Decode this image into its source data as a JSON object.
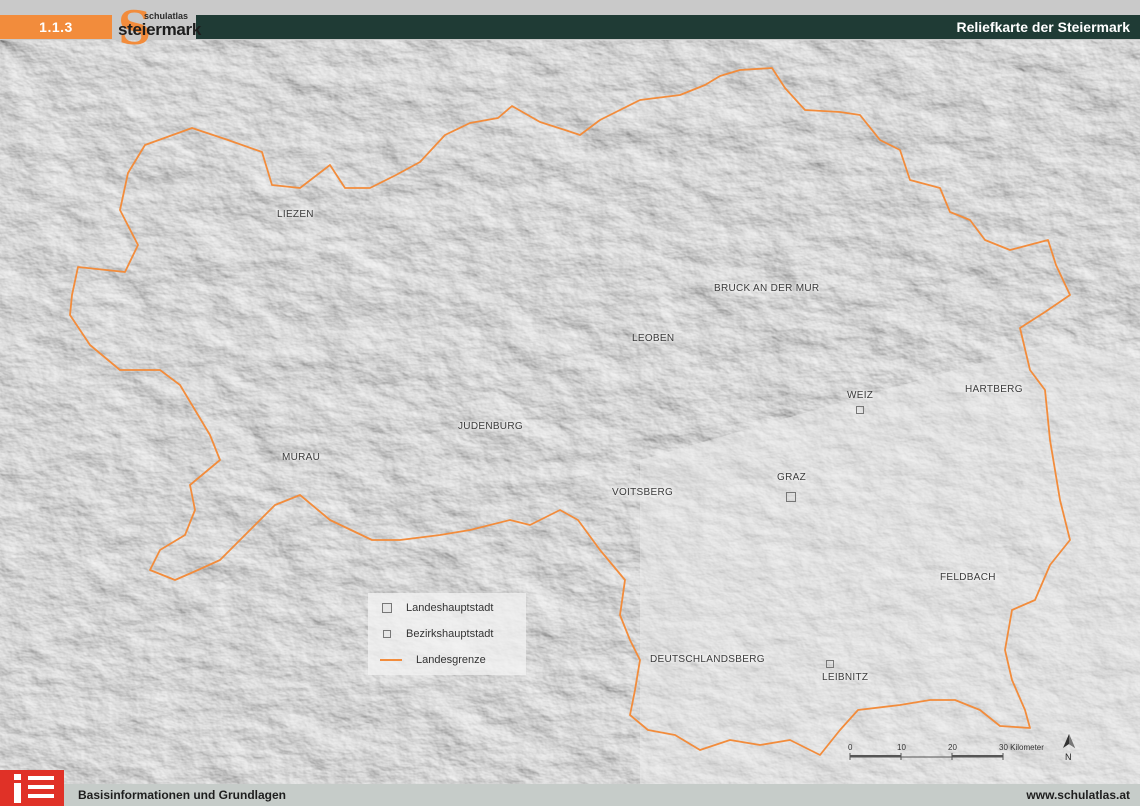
{
  "header": {
    "chapter": "1.1.3",
    "logo_top": "schulatlas",
    "logo_main": "steiermark",
    "logo_letter": "S",
    "title": "Reliefkarte der Steiermark"
  },
  "colors": {
    "accent": "#f28c3c",
    "title_bar": "#1f3b35",
    "border": "#f28c3c",
    "footer_logo": "#e03127"
  },
  "map": {
    "cities": {
      "liezen": "LIEZEN",
      "bruck": "BRUCK AN DER MUR",
      "leoben": "LEOBEN",
      "weiz": "WEIZ",
      "hartberg": "HARTBERG",
      "judenburg": "JUDENBURG",
      "murau": "MURAU",
      "graz": "GRAZ",
      "voitsberg": "VOITSBERG",
      "feldbach": "FELDBACH",
      "deutschlandsberg": "DEUTSCHLANDSBERG",
      "leibnitz": "LEIBNITZ"
    }
  },
  "legend": {
    "capital": "Landeshauptstadt",
    "district": "Bezirkshauptstadt",
    "border": "Landesgrenze"
  },
  "scale": {
    "ticks": [
      "0",
      "10",
      "20",
      "30 Kilometer"
    ]
  },
  "north_label": "N",
  "footer": {
    "left": "Basisinformationen und Grundlagen",
    "right": "www.schulatlas.at"
  }
}
